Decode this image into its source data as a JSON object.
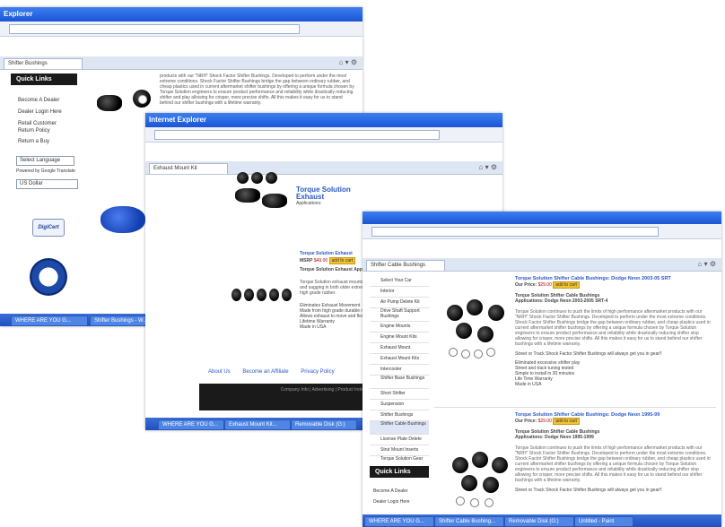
{
  "window1": {
    "title": "Explorer",
    "tab_label": "Shifter Bushings",
    "quick_links": "Quick Links",
    "side_links": [
      "Become A Dealer",
      "Dealer Login Here",
      "Retail Customer Return Policy",
      "Return a Buy"
    ],
    "language_select": "Select Language",
    "powered_by": "Powered by Google Translate",
    "currency_select": "US Dollar",
    "paragraph": "products with our \"NRH\" Shock Factor Shifter Bushings. Developed to perform under the most extreme conditions. Shock Factor Shifter Bushings bridge the gap between ordinary rubber, and cheap plastics used in current aftermarket shifter bushings by offering a unique formula chosen by Torque Solution engineers to ensure product performance and reliability while drastically reducing shifter and play allowing for crisper, more precise shifts. All this makes it easy for us to stand behind our shifter bushings with a lifetime warranty."
  },
  "window2": {
    "title": "Internet Explorer",
    "tab_label": "Exhaust Mount Kit",
    "product_title": "Torque Solution Exhaust",
    "price_label": "MSRP",
    "price": "$49.00",
    "add_to_cart": "add to cart",
    "apps_label": "Torque Solution Exhaust",
    "applications": "Applications:",
    "desc": "Torque Solution exhaust mounts replace the factory rubber mounts, which are prone to tearing and sagging in both older extreme vehicles and high performance applications. Made from high grade rubber.",
    "bullets": [
      "Eliminates Exhaust Movement",
      "Made from high grade durable material",
      "Allows exhaust to move and flex",
      "Lifetime Warranty",
      "Made in USA"
    ],
    "footer_links": [
      "About Us",
      "Become an Affiliate",
      "Privacy Policy"
    ],
    "footer_text": "Company Info  |  Advertising  |  Product Index  |  Careers  |  Copyright © 2009 Torque Solution. All Rights Reserved."
  },
  "window3": {
    "tab_label": "Shifter Cable Bushings",
    "nav_items": [
      "Select Your Car",
      "Interior",
      "Air Pump Delete Kit",
      "Drive Shaft Support Bushings",
      "Engine Mounts",
      "Engine Mount Kits",
      "Exhaust Mount",
      "Exhaust Mount Kits",
      "Intercooler",
      "Shifter Base Bushings",
      "Short Shifter",
      "Suspension",
      "Shifter Bushings",
      "Shifter Cable Bushings",
      "License Plate Delete",
      "Strut Mount Inserts",
      "Torque Solution Gear"
    ],
    "quick_links": "Quick Links",
    "side_links": [
      "Become A Dealer",
      "Dealer Login Here"
    ],
    "products": [
      {
        "title": "Torque Solution Shifter Cable Bushings: Dodge Neon 2003-05 SRT",
        "price_label": "Our Price:",
        "price": "$29.00",
        "add_to_cart": "add to cart",
        "subtitle": "Torque Solution Shifter Cable Bushings",
        "applications": "Applications: Dodge Neon 2003-2005 SRT-4",
        "desc": "Torque Solution continues to push the limits of high performance aftermarket products with our \"NRH\" Shock Factor Shifter Bushings. Developed to perform under the most extreme conditions. Shock Factor Shifter Bushings bridge the gap between ordinary rubber, and cheap plastics used in current aftermarket shifter bushings by offering a unique formula chosen by Torque Solution engineers to ensure product performance and reliability while drastically reducing shifter slop allowing for crisper, more precise shifts. All this makes it easy for us to stand behind our shifter bushings with a lifetime warranty.",
        "tagline": "Street or Track Shock Factor Shifter Bushings will always get you in gear!!",
        "bullets": [
          "Eliminated excessive shifter play",
          "Street and track tuning tested",
          "Simple to install in 30 minutes",
          "Life Time Warranty",
          "Made in USA"
        ]
      },
      {
        "title": "Torque Solution Shifter Cable Bushings: Dodge Neon 1995-99",
        "price_label": "Our Price:",
        "price": "$29.00",
        "add_to_cart": "add to cart",
        "subtitle": "Torque Solution Shifter Cable Bushings",
        "applications": "Applications: Dodge Neon 1995-1999",
        "desc": "Torque Solution continues to push the limits of high performance aftermarket products with our \"NRH\" Shock Factor Shifter Bushings. Developed to perform under the most extreme conditions. Shock Factor Shifter Bushings bridge the gap between ordinary rubber, and cheap plastics used in current aftermarket shifter bushings by offering a unique formula chosen by Torque Solution engineers to ensure product performance and reliability while drastically reducing shifter slop allowing for crisper, more precise shifts. All this makes it easy for us to stand behind our shifter bushings with a lifetime warranty.",
        "tagline": "Street or Track Shock Factor Shifter Bushings will always get you in gear!!"
      }
    ]
  },
  "taskbar": {
    "items1": [
      "WHERE ARE YOU G...",
      "Shifter Bushings - W..."
    ],
    "items2": [
      "WHERE ARE YOU G...",
      "Exhaust Mount Kit...",
      "Removable Disk (G:)"
    ],
    "items3": [
      "WHERE ARE YOU G...",
      "Shifter Cable Bushing...",
      "Removable Disk (G:)",
      "Untitled - Paint"
    ]
  },
  "colors": {
    "titlebar": "#1b55d6",
    "accent_link": "#2a58c8",
    "price": "#bb0000",
    "bushing_blue": "#1a4fd0"
  }
}
